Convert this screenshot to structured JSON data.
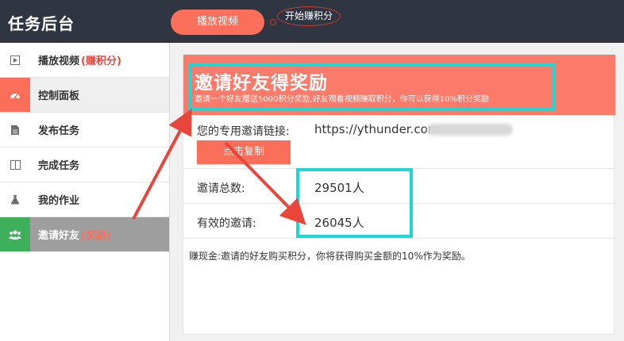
{
  "header": {
    "brand": "任务后台",
    "play_button": "播放视频",
    "bubble": "开始赚积分"
  },
  "sidebar": {
    "items": [
      {
        "icon": "play-icon",
        "label": "播放视频",
        "tag": "(赚积分)"
      },
      {
        "icon": "dashboard-icon",
        "label": "控制面板",
        "tag": ""
      },
      {
        "icon": "document-icon",
        "label": "发布任务",
        "tag": ""
      },
      {
        "icon": "columns-icon",
        "label": "完成任务",
        "tag": ""
      },
      {
        "icon": "flask-icon",
        "label": "我的作业",
        "tag": ""
      },
      {
        "icon": "users-icon",
        "label": "邀请好友",
        "tag": "(奖励)"
      }
    ]
  },
  "card": {
    "title": "邀请好友得奖励",
    "subtitle": "邀请一个好友赠送5000积分奖励,好友观看视频赚取积分，你可以获得10%积分奖励",
    "link_label": "您的专用邀请链接:",
    "link_value": "https://ythunder.com",
    "copy_button": "点击复制",
    "total_label": "邀请总数:",
    "total_value": "29501人",
    "valid_label": "有效的邀请:",
    "valid_value": "26045人",
    "note": "赚现金:邀请的好友购买积分，你将获得购买金额的10%作为奖励。"
  },
  "colors": {
    "topbar": "#2f3641",
    "accent": "#fb6f5a",
    "header_card": "#fb7a6a",
    "highlight": "#1ed7d3",
    "arrow": "#e8463a",
    "invite_active": "#9e9e9e",
    "invite_icon": "#3eaf5a"
  }
}
